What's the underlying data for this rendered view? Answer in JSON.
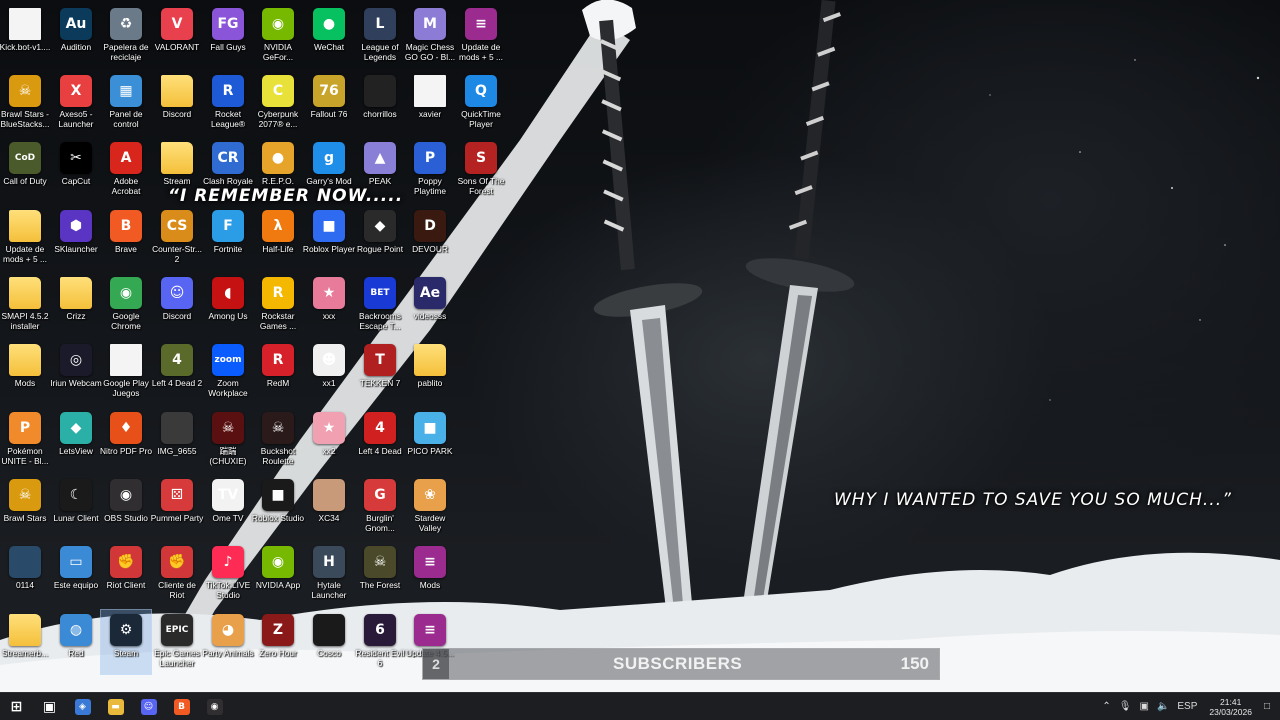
{
  "wallpaper": {
    "quote_top": "“I REMEMBER NOW.....",
    "quote_bottom": "WHY I WANTED TO SAVE YOU SO MUCH...”"
  },
  "desktop": {
    "icons": [
      {
        "label": "Kick.bot-v1....",
        "icon": "file-icon",
        "glyph": "",
        "bg": "#f2f2f2",
        "kind": "file"
      },
      {
        "label": "Audition",
        "icon": "audition-icon",
        "glyph": "Au",
        "bg": "#0b3a5a"
      },
      {
        "label": "Papelera de reciclaje",
        "icon": "recycle-bin-icon",
        "glyph": "♻",
        "bg": "#6b7a88"
      },
      {
        "label": "VALORANT",
        "icon": "valorant-icon",
        "glyph": "V",
        "bg": "#e8404d"
      },
      {
        "label": "Fall Guys",
        "icon": "fall-guys-icon",
        "glyph": "FG",
        "bg": "#8a55d8"
      },
      {
        "label": "NVIDIA GeFor...",
        "icon": "nvidia-icon",
        "glyph": "◉",
        "bg": "#76b900"
      },
      {
        "label": "WeChat",
        "icon": "wechat-icon",
        "glyph": "●",
        "bg": "#07c160"
      },
      {
        "label": "League of Legends",
        "icon": "league-icon",
        "glyph": "L",
        "bg": "#2f3f5c"
      },
      {
        "label": "Magic Chess GO GO - Bl...",
        "icon": "magic-chess-icon",
        "glyph": "M",
        "bg": "#8c7cd6"
      },
      {
        "label": "Update de mods + 5 ...",
        "icon": "winrar-icon",
        "glyph": "≡",
        "bg": "#9b2b8f"
      },
      {
        "label": "Brawl Stars - BlueStacks...",
        "icon": "brawl-stars-icon",
        "glyph": "☠",
        "bg": "#d99a10"
      },
      {
        "label": "Axeso5 - Launcher",
        "icon": "axeso5-icon",
        "glyph": "X",
        "bg": "#e84040"
      },
      {
        "label": "Panel de control",
        "icon": "control-panel-icon",
        "glyph": "▦",
        "bg": "#3a8fd6"
      },
      {
        "label": "Discord",
        "icon": "folder-icon",
        "glyph": "",
        "bg": "",
        "kind": "folder"
      },
      {
        "label": "Rocket League®",
        "icon": "rocket-league-icon",
        "glyph": "R",
        "bg": "#1e5ad6"
      },
      {
        "label": "Cyberpunk 2077® e...",
        "icon": "cyberpunk-icon",
        "glyph": "C",
        "bg": "#e8e13a"
      },
      {
        "label": "Fallout 76",
        "icon": "fallout-icon",
        "glyph": "76",
        "bg": "#c9a42a"
      },
      {
        "label": "chorrillos",
        "icon": "photo-icon",
        "glyph": "",
        "bg": "#222222"
      },
      {
        "label": "xavier",
        "icon": "file-icon",
        "glyph": "",
        "bg": "#f2f2f2",
        "kind": "file"
      },
      {
        "label": "QuickTime Player",
        "icon": "quicktime-icon",
        "glyph": "Q",
        "bg": "#1e88e5"
      },
      {
        "label": "Call of Duty",
        "icon": "call-of-duty-icon",
        "glyph": "CoD",
        "bg": "#4a5a2a"
      },
      {
        "label": "CapCut",
        "icon": "capcut-icon",
        "glyph": "✂",
        "bg": "#000000"
      },
      {
        "label": "Adobe Acrobat",
        "icon": "acrobat-icon",
        "glyph": "A",
        "bg": "#d9261c"
      },
      {
        "label": "Stream",
        "icon": "folder-icon",
        "glyph": "",
        "bg": "",
        "kind": "folder"
      },
      {
        "label": "Clash Royale",
        "icon": "clash-royale-icon",
        "glyph": "CR",
        "bg": "#2f6bd1"
      },
      {
        "label": "R.E.P.O.",
        "icon": "repo-icon",
        "glyph": "●",
        "bg": "#e6a52a"
      },
      {
        "label": "Garry's Mod",
        "icon": "garrys-mod-icon",
        "glyph": "g",
        "bg": "#1f8ee8"
      },
      {
        "label": "PEAK",
        "icon": "peak-icon",
        "glyph": "▲",
        "bg": "#8a7fd6"
      },
      {
        "label": "Poppy Playtime",
        "icon": "poppy-playtime-icon",
        "glyph": "P",
        "bg": "#2b5fd6"
      },
      {
        "label": "Sons Of The Forest",
        "icon": "sons-forest-icon",
        "glyph": "S",
        "bg": "#b52222"
      },
      {
        "label": "Update de mods + 5 ...",
        "icon": "folder-icon",
        "glyph": "",
        "bg": "",
        "kind": "folder"
      },
      {
        "label": "SKlauncher",
        "icon": "sklauncher-icon",
        "glyph": "⬢",
        "bg": "#5a34c2"
      },
      {
        "label": "Brave",
        "icon": "brave-icon",
        "glyph": "B",
        "bg": "#f15a22"
      },
      {
        "label": "Counter-Str... 2",
        "icon": "counter-strike-icon",
        "glyph": "CS",
        "bg": "#d98c1a"
      },
      {
        "label": "Fortnite",
        "icon": "fortnite-icon",
        "glyph": "F",
        "bg": "#2b9ce6"
      },
      {
        "label": "Half-Life",
        "icon": "half-life-icon",
        "glyph": "λ",
        "bg": "#f07a10"
      },
      {
        "label": "Roblox Player",
        "icon": "roblox-icon",
        "glyph": "■",
        "bg": "#2f6bf0"
      },
      {
        "label": "Rogue Point",
        "icon": "rogue-point-icon",
        "glyph": "◆",
        "bg": "#2a2a2a"
      },
      {
        "label": "DEVOUR",
        "icon": "devour-icon",
        "glyph": "D",
        "bg": "#3a1a10"
      },
      {
        "label": "SMAPI 4.5.2 installer",
        "icon": "folder-icon",
        "glyph": "",
        "bg": "",
        "kind": "folder"
      },
      {
        "label": "Crizz",
        "icon": "folder-icon",
        "glyph": "",
        "bg": "",
        "kind": "folder"
      },
      {
        "label": "Google Chrome",
        "icon": "chrome-icon",
        "glyph": "◉",
        "bg": "#34a853"
      },
      {
        "label": "Discord",
        "icon": "discord-icon",
        "glyph": "☺",
        "bg": "#5865f2"
      },
      {
        "label": "Among Us",
        "icon": "among-us-icon",
        "glyph": "◖",
        "bg": "#c51111"
      },
      {
        "label": "Rockstar Games ...",
        "icon": "rockstar-icon",
        "glyph": "R",
        "bg": "#f5b800"
      },
      {
        "label": "xxx",
        "icon": "photo-icon",
        "glyph": "★",
        "bg": "#e87a9a"
      },
      {
        "label": "Backrooms Escape T...",
        "icon": "backrooms-icon",
        "glyph": "BET",
        "bg": "#1a3ad6"
      },
      {
        "label": "videosss",
        "icon": "after-effects-icon",
        "glyph": "Ae",
        "bg": "#2a2a6a"
      },
      {
        "label": "Mods",
        "icon": "folder-icon",
        "glyph": "",
        "bg": "",
        "kind": "folder"
      },
      {
        "label": "Iriun Webcam",
        "icon": "iriun-icon",
        "glyph": "◎",
        "bg": "#1a1a2a"
      },
      {
        "label": "Google Play Juegos",
        "icon": "file-icon",
        "glyph": "",
        "bg": "#f2f2f2",
        "kind": "file"
      },
      {
        "label": "Left 4 Dead 2",
        "icon": "left4dead2-icon",
        "glyph": "4",
        "bg": "#5a6a2a"
      },
      {
        "label": "Zoom Workplace",
        "icon": "zoom-icon",
        "glyph": "zoom",
        "bg": "#0b5cff"
      },
      {
        "label": "RedM",
        "icon": "redm-icon",
        "glyph": "R",
        "bg": "#d6202a"
      },
      {
        "label": "xx1",
        "icon": "photo-icon",
        "glyph": "☻",
        "bg": "#f0f0f0"
      },
      {
        "label": "TEKKEN 7",
        "icon": "tekken-icon",
        "glyph": "T",
        "bg": "#b02020"
      },
      {
        "label": "pablito",
        "icon": "folder-icon",
        "glyph": "",
        "bg": "",
        "kind": "folder"
      },
      {
        "label": "Pokémon UNITE - Bl...",
        "icon": "pokemon-unite-icon",
        "glyph": "P",
        "bg": "#f08a2a"
      },
      {
        "label": "LetsView",
        "icon": "letsview-icon",
        "glyph": "◆",
        "bg": "#2ab0a6"
      },
      {
        "label": "Nitro PDF Pro",
        "icon": "nitro-pdf-icon",
        "glyph": "♦",
        "bg": "#e8501a"
      },
      {
        "label": "IMG_9655",
        "icon": "photo-icon",
        "glyph": "",
        "bg": "#3a3a3a"
      },
      {
        "label": "踹踹 (CHUXIE)",
        "icon": "chuxie-icon",
        "glyph": "☠",
        "bg": "#5a1010"
      },
      {
        "label": "Buckshot Roulette",
        "icon": "buckshot-icon",
        "glyph": "☠",
        "bg": "#2a1a1a"
      },
      {
        "label": "xx2",
        "icon": "photo-icon",
        "glyph": "★",
        "bg": "#f0a0b0"
      },
      {
        "label": "Left 4 Dead",
        "icon": "left4dead-icon",
        "glyph": "4",
        "bg": "#d02020"
      },
      {
        "label": "PICO PARK",
        "icon": "pico-park-icon",
        "glyph": "■",
        "bg": "#4ab0e8"
      },
      {
        "label": "Brawl Stars",
        "icon": "brawl-stars-icon",
        "glyph": "☠",
        "bg": "#d99a10"
      },
      {
        "label": "Lunar Client",
        "icon": "lunar-client-icon",
        "glyph": "☾",
        "bg": "#1a1a1a"
      },
      {
        "label": "OBS Studio",
        "icon": "obs-icon",
        "glyph": "◉",
        "bg": "#302e31"
      },
      {
        "label": "Pummel Party",
        "icon": "pummel-party-icon",
        "glyph": "⚄",
        "bg": "#d63a3a"
      },
      {
        "label": "Ome TV",
        "icon": "ome-tv-icon",
        "glyph": "TV",
        "bg": "#f2f2f2"
      },
      {
        "label": "Roblox Studio",
        "icon": "roblox-studio-icon",
        "glyph": "■",
        "bg": "#1a1a1a"
      },
      {
        "label": "XC34",
        "icon": "photo-icon",
        "glyph": "",
        "bg": "#c89a7a"
      },
      {
        "label": "Burglin' Gnom...",
        "icon": "burglin-gnomes-icon",
        "glyph": "G",
        "bg": "#d63a3a"
      },
      {
        "label": "Stardew Valley",
        "icon": "stardew-icon",
        "glyph": "❀",
        "bg": "#e8a04a"
      },
      {
        "label": "0114",
        "icon": "photo-icon",
        "glyph": "",
        "bg": "#2a4a6a"
      },
      {
        "label": "Este equipo",
        "icon": "this-pc-icon",
        "glyph": "▭",
        "bg": "#3a8ad6"
      },
      {
        "label": "Riot Client",
        "icon": "riot-client-icon",
        "glyph": "✊",
        "bg": "#d13639"
      },
      {
        "label": "Cliente de Riot",
        "icon": "riot-client-icon",
        "glyph": "✊",
        "bg": "#d13639"
      },
      {
        "label": "TikTok LIVE Studio",
        "icon": "tiktok-live-icon",
        "glyph": "♪",
        "bg": "#fe2c55"
      },
      {
        "label": "NVIDIA App",
        "icon": "nvidia-icon",
        "glyph": "◉",
        "bg": "#76b900"
      },
      {
        "label": "Hytale Launcher",
        "icon": "hytale-icon",
        "glyph": "H",
        "bg": "#3a4a5a"
      },
      {
        "label": "The Forest",
        "icon": "the-forest-icon",
        "glyph": "☠",
        "bg": "#4a4a2a"
      },
      {
        "label": "Mods",
        "icon": "winrar-icon",
        "glyph": "≡",
        "bg": "#9b2b8f"
      },
      {
        "label": "Streamerb...",
        "icon": "folder-icon",
        "glyph": "",
        "bg": "",
        "kind": "folder"
      },
      {
        "label": "Red",
        "icon": "network-icon",
        "glyph": "◍",
        "bg": "#3a8ad6"
      },
      {
        "label": "Steam",
        "icon": "steam-icon",
        "glyph": "⚙",
        "bg": "#1b2838"
      },
      {
        "label": "Epic Games Launcher",
        "icon": "epic-games-icon",
        "glyph": "EPIC",
        "bg": "#2a2a2a"
      },
      {
        "label": "Party Animals",
        "icon": "party-animals-icon",
        "glyph": "◕",
        "bg": "#e8a04a"
      },
      {
        "label": "Zero Hour",
        "icon": "zero-hour-icon",
        "glyph": "Z",
        "bg": "#8a1a1a"
      },
      {
        "label": "Cosco",
        "icon": "photo-icon",
        "glyph": "",
        "bg": "#1a1a1a"
      },
      {
        "label": "Resident Evil 6",
        "icon": "resident-evil-icon",
        "glyph": "6",
        "bg": "#2a1a3a"
      },
      {
        "label": "Update 4.5...",
        "icon": "winrar-icon",
        "glyph": "≡",
        "bg": "#9b2b8f"
      }
    ]
  },
  "overlay": {
    "left_value": "2",
    "label": "SUBSCRIBERS",
    "count": "150"
  },
  "taskbar": {
    "apps": [
      {
        "name": "taskbar-start-button",
        "icon": "windows-start-icon",
        "glyph": "⊞",
        "bg": "transparent"
      },
      {
        "name": "taskbar-task-view",
        "icon": "task-view-icon",
        "glyph": "▣",
        "bg": "transparent"
      },
      {
        "name": "taskbar-copilot",
        "icon": "copilot-icon",
        "glyph": "◈",
        "bg": "#3a7ad6"
      },
      {
        "name": "taskbar-file-explorer",
        "icon": "folder-icon",
        "glyph": "▬",
        "bg": "#e8b93a"
      },
      {
        "name": "taskbar-discord",
        "icon": "discord-icon",
        "glyph": "☺",
        "bg": "#5865f2"
      },
      {
        "name": "taskbar-brave",
        "icon": "brave-icon",
        "glyph": "B",
        "bg": "#f15a22"
      },
      {
        "name": "taskbar-obs",
        "icon": "obs-icon",
        "glyph": "◉",
        "bg": "#302e31"
      }
    ],
    "language": "ESP",
    "time": "21:41",
    "date": "23/03/2026"
  }
}
